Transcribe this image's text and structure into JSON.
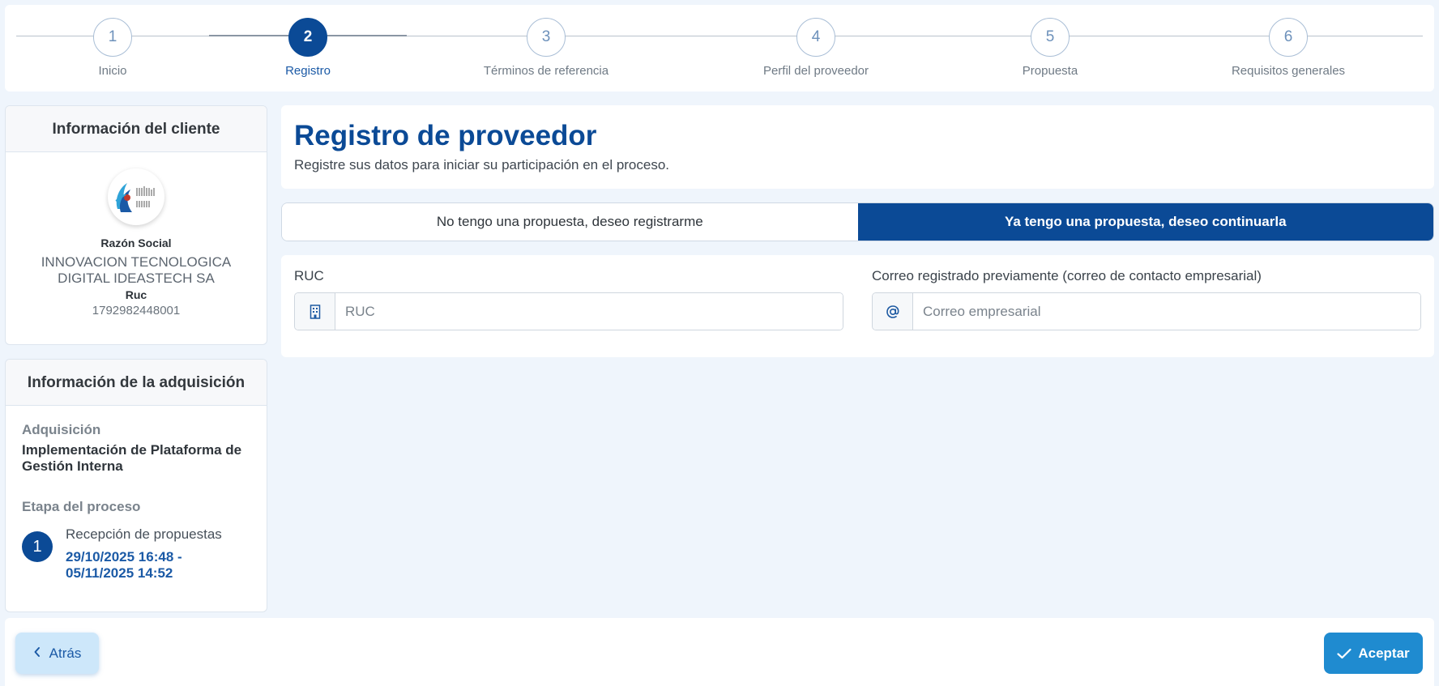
{
  "stepper": {
    "steps": [
      {
        "number": "1",
        "label": "Inicio"
      },
      {
        "number": "2",
        "label": "Registro"
      },
      {
        "number": "3",
        "label": "Términos de referencia"
      },
      {
        "number": "4",
        "label": "Perfil del proveedor"
      },
      {
        "number": "5",
        "label": "Propuesta"
      },
      {
        "number": "6",
        "label": "Requisitos generales"
      }
    ],
    "active_step": "2"
  },
  "client": {
    "header": "Información del cliente",
    "razon_label": "Razón Social",
    "razon_value": "INNOVACION TECNOLOGICA DIGITAL IDEASTECH SA",
    "ruc_label": "Ruc",
    "ruc_value": "1792982448001"
  },
  "acquisition": {
    "header": "Información de la adquisición",
    "label": "Adquisición",
    "value": "Implementación de Plataforma de Gestión Interna",
    "stage_label": "Etapa del proceso",
    "stage_number": "1",
    "stage_name": "Recepción de propuestas",
    "stage_dates": "29/10/2025 16:48 - 05/11/2025 14:52"
  },
  "main": {
    "title": "Registro de proveedor",
    "subtitle": "Registre sus datos para iniciar su participación en el proceso.",
    "toggle_new": "No tengo una propuesta, deseo registrarme",
    "toggle_existing": "Ya tengo una propuesta, deseo continuarla",
    "ruc_label": "RUC",
    "ruc_placeholder": "RUC",
    "email_label": "Correo registrado previamente (correo de contacto empresarial)",
    "email_placeholder": "Correo empresarial",
    "ruc_addon_icon": "building-icon",
    "email_addon_icon": "at-icon"
  },
  "footer": {
    "back_label": "Atrás",
    "accept_label": "Aceptar"
  },
  "colors": {
    "primary": "#0b4a96",
    "accept": "#1f8bd0",
    "back": "#cde7fa"
  }
}
